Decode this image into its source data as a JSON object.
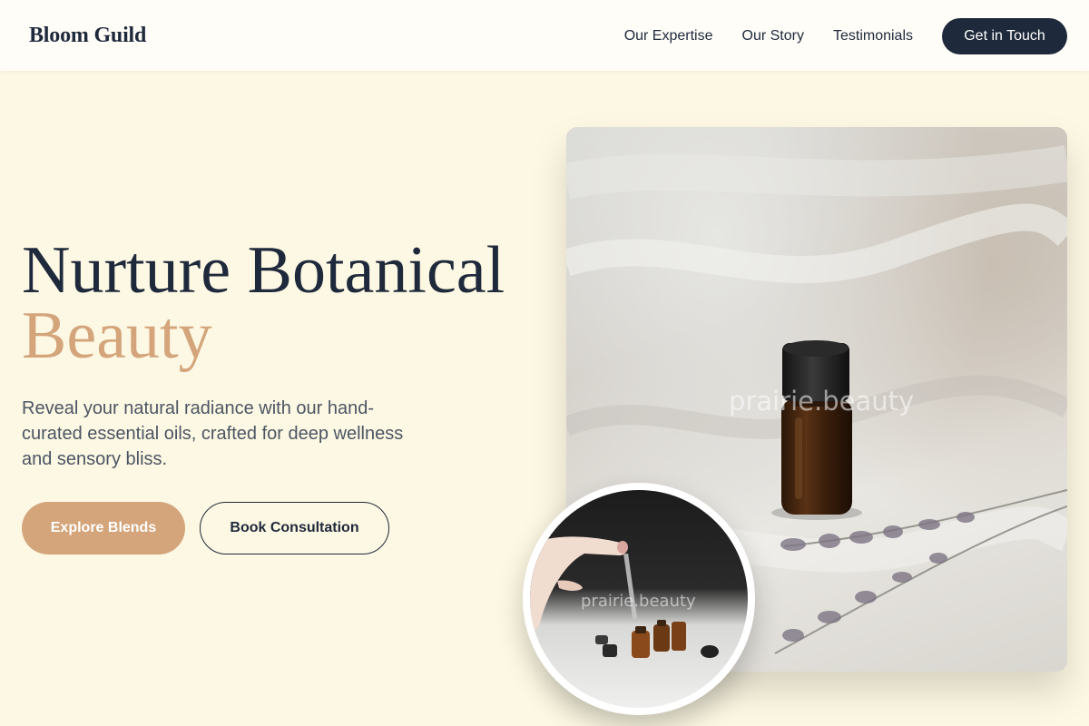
{
  "header": {
    "logo": "Bloom Guild",
    "nav": {
      "expertise": "Our Expertise",
      "story": "Our Story",
      "testimonials": "Testimonials"
    },
    "cta_label": "Get in Touch"
  },
  "hero": {
    "title_line1": "Nurture Botanical",
    "title_line2": "Beauty",
    "description": "Reveal your natural radiance with our hand-curated essential oils, crafted for deep wellness and sensory bliss.",
    "primary_button": "Explore Blends",
    "secondary_button": "Book Consultation"
  },
  "images": {
    "main_watermark": "prairie.beauty",
    "circle_watermark": "prairie.beauty"
  },
  "colors": {
    "background": "#fdf8e3",
    "navy": "#1e293b",
    "accent": "#d4a57b",
    "body_text": "#4b5563"
  }
}
